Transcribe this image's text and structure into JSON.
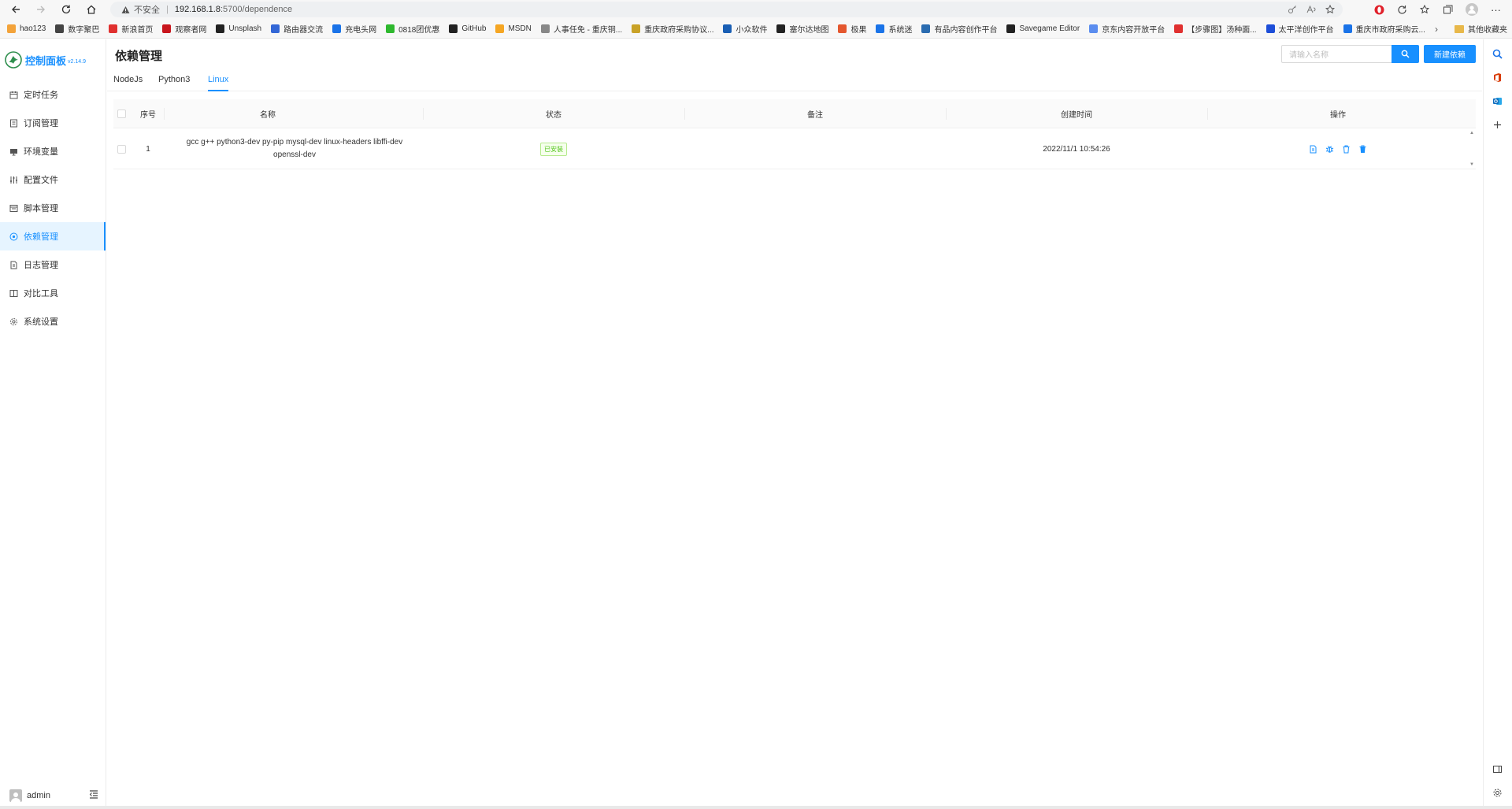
{
  "browser": {
    "insecure_label": "不安全",
    "url_host": "192.168.1.8",
    "url_path": ":5700/dependence"
  },
  "bookmarks": [
    {
      "label": "hao123",
      "color": "#f3a33a"
    },
    {
      "label": "数字聚巴",
      "color": "#444444"
    },
    {
      "label": "新浪首页",
      "color": "#e0302f"
    },
    {
      "label": "观察者网",
      "color": "#c8161d"
    },
    {
      "label": "Unsplash",
      "color": "#222222"
    },
    {
      "label": "路由器交流",
      "color": "#3367d6"
    },
    {
      "label": "充电头网",
      "color": "#1a73e8"
    },
    {
      "label": "0818团优惠",
      "color": "#2eb82e"
    },
    {
      "label": "GitHub",
      "color": "#222222"
    },
    {
      "label": "MSDN",
      "color": "#f5a623"
    },
    {
      "label": "人事任免 - 重庆铜...",
      "color": "#888888"
    },
    {
      "label": "重庆政府采购协议...",
      "color": "#c9a227"
    },
    {
      "label": "小众软件",
      "color": "#1a5fb4"
    },
    {
      "label": "塞尔达地图",
      "color": "#222222"
    },
    {
      "label": "极果",
      "color": "#e4572e"
    },
    {
      "label": "系统迷",
      "color": "#1a73e8"
    },
    {
      "label": "有品内容创作平台",
      "color": "#2b6cb0"
    },
    {
      "label": "Savegame Editor",
      "color": "#222222"
    },
    {
      "label": "京东内容开放平台",
      "color": "#5b8def"
    },
    {
      "label": "【步骤图】汤种面...",
      "color": "#e0302f"
    },
    {
      "label": "太平洋创作平台",
      "color": "#1d4ed8"
    },
    {
      "label": "重庆市政府采购云...",
      "color": "#1a73e8"
    }
  ],
  "bookmarks_other": "其他收藏夹",
  "app": {
    "title": "控制面板",
    "version": "v2.14.9",
    "accent": "#1890ff"
  },
  "menu": [
    {
      "label": "定时任务",
      "icon": "calendar-icon"
    },
    {
      "label": "订阅管理",
      "icon": "subscribe-icon"
    },
    {
      "label": "环境变量",
      "icon": "monitor-icon"
    },
    {
      "label": "配置文件",
      "icon": "sliders-icon"
    },
    {
      "label": "脚本管理",
      "icon": "script-icon"
    },
    {
      "label": "依赖管理",
      "icon": "dependency-icon",
      "active": true
    },
    {
      "label": "日志管理",
      "icon": "log-icon"
    },
    {
      "label": "对比工具",
      "icon": "diff-icon"
    },
    {
      "label": "系统设置",
      "icon": "gear-icon"
    }
  ],
  "user": {
    "name": "admin"
  },
  "page": {
    "title": "依赖管理",
    "search_placeholder": "请输入名称",
    "new_button": "新建依赖"
  },
  "tabs": [
    {
      "label": "NodeJs"
    },
    {
      "label": "Python3"
    },
    {
      "label": "Linux",
      "active": true
    }
  ],
  "table": {
    "columns": [
      "序号",
      "名称",
      "状态",
      "备注",
      "创建时间",
      "操作"
    ],
    "rows": [
      {
        "index": "1",
        "name_line1": "gcc g++ python3-dev py-pip mysql-dev linux-headers libffi-dev",
        "name_line2": "openssl-dev",
        "status": "已安装",
        "remark": "",
        "created": "2022/11/1 10:54:26",
        "actions": [
          "log-icon",
          "reinstall-icon",
          "delete-icon",
          "force-delete-icon"
        ]
      }
    ]
  }
}
